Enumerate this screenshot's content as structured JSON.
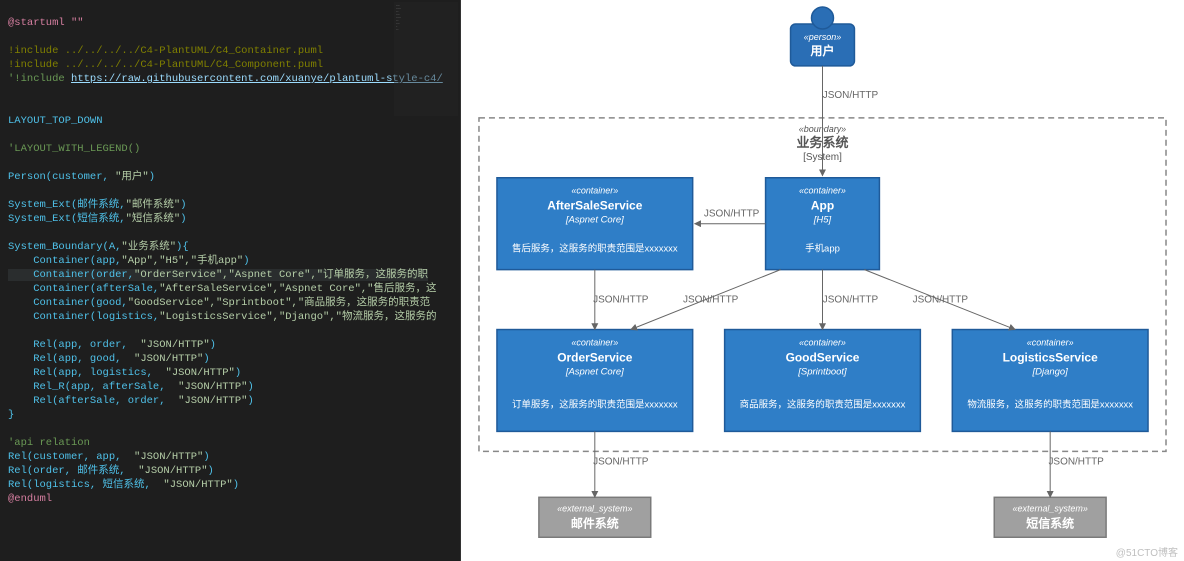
{
  "code": {
    "l1": "@startuml \"\"",
    "l2": "!include ../../../../C4-PlantUML/C4_Container.puml",
    "l3": "!include ../../../../C4-PlantUML/C4_Component.puml",
    "l4a": "'!include ",
    "l4b": "https://raw.githubusercontent.com/xuanye/plantuml-style-c4/",
    "l5": "LAYOUT_TOP_DOWN",
    "l6": "'LAYOUT_WITH_LEGEND()",
    "l7a": "Person(customer, ",
    "l7b": "\"用户\"",
    "l7c": ")",
    "l8a": "System_Ext(邮件系统,",
    "l8b": "\"邮件系统\"",
    "l8c": ")",
    "l9a": "System_Ext(短信系统,",
    "l9b": "\"短信系统\"",
    "l9c": ")",
    "l10a": "System_Boundary(A,",
    "l10b": "\"业务系统\"",
    "l10c": "){",
    "l11a": "    Container(app,",
    "l11b": "\"App\",\"H5\",\"手机app\"",
    "l11c": ")",
    "l12a": "    Container(order,",
    "l12b": "\"OrderService\",\"Aspnet Core\",\"订单服务，这服务的职",
    "l12c": "",
    "l13a": "    Container(afterSale,",
    "l13b": "\"AfterSaleService\",\"Aspnet Core\",\"售后服务，这",
    "l13c": "",
    "l14a": "    Container(good,",
    "l14b": "\"GoodService\",\"Sprintboot\",\"商品服务，这服务的职责范",
    "l14c": "",
    "l15a": "    Container(logistics,",
    "l15b": "\"LogisticsService\",\"Django\",\"物流服务，这服务的",
    "l15c": "",
    "l16a": "    Rel(app, order,  ",
    "l16b": "\"JSON/HTTP\"",
    "l16c": ")",
    "l17a": "    Rel(app, good,  ",
    "l17b": "\"JSON/HTTP\"",
    "l17c": ")",
    "l18a": "    Rel(app, logistics,  ",
    "l18b": "\"JSON/HTTP\"",
    "l18c": ")",
    "l19a": "    Rel_R(app, afterSale,  ",
    "l19b": "\"JSON/HTTP\"",
    "l19c": ")",
    "l20a": "    Rel(afterSale, order,  ",
    "l20b": "\"JSON/HTTP\"",
    "l20c": ")",
    "l21": "}",
    "l22": "'api relation",
    "l23a": "Rel(customer, app,  ",
    "l23b": "\"JSON/HTTP\"",
    "l23c": ")",
    "l24a": "Rel(order, 邮件系统,  ",
    "l24b": "\"JSON/HTTP\"",
    "l24c": ")",
    "l25a": "Rel(logistics, 短信系统,  ",
    "l25b": "\"JSON/HTTP\"",
    "l25c": ")",
    "l26": "@enduml"
  },
  "diagram": {
    "boundary": {
      "st": "«boundary»",
      "title": "业务系统",
      "sub": "[System]"
    },
    "person": {
      "st": "«person»",
      "title": "用户"
    },
    "app": {
      "st": "«container»",
      "title": "App",
      "tech": "[H5]",
      "desc": "手机app"
    },
    "aftersale": {
      "st": "«container»",
      "title": "AfterSaleService",
      "tech": "[Aspnet Core]",
      "desc": "售后服务，这服务的职责范围是xxxxxxx"
    },
    "order": {
      "st": "«container»",
      "title": "OrderService",
      "tech": "[Aspnet Core]",
      "desc": "订单服务，这服务的职责范围是xxxxxxx"
    },
    "good": {
      "st": "«container»",
      "title": "GoodService",
      "tech": "[Sprintboot]",
      "desc": "商品服务，这服务的职责范围是xxxxxxx"
    },
    "logistics": {
      "st": "«container»",
      "title": "LogisticsService",
      "tech": "[Django]",
      "desc": "物流服务，这服务的职责范围是xxxxxxx"
    },
    "mail": {
      "st": "«external_system»",
      "title": "邮件系统"
    },
    "sms": {
      "st": "«external_system»",
      "title": "短信系统"
    },
    "edge": "JSON/HTTP"
  },
  "watermark": "@51CTO博客"
}
